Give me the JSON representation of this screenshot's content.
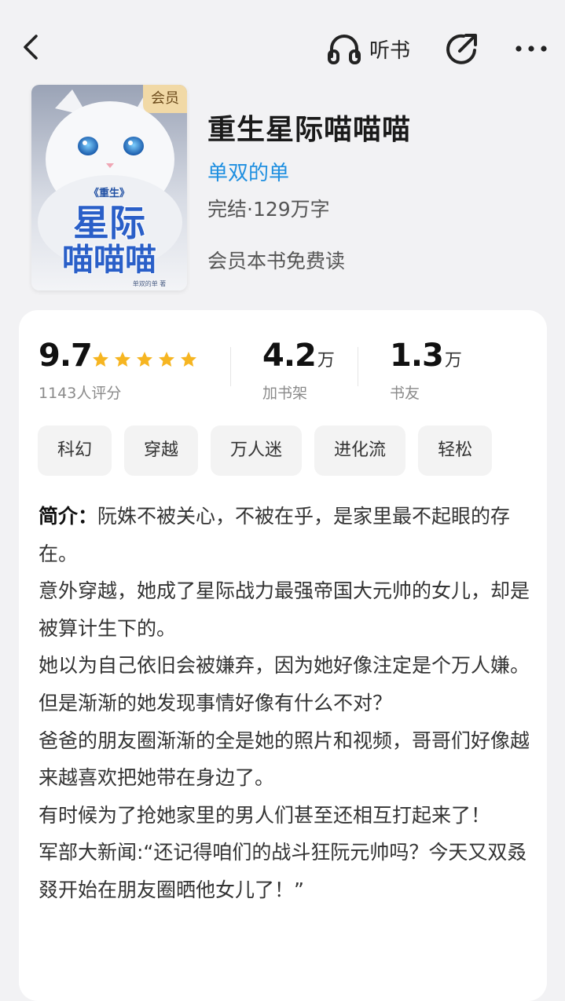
{
  "topbar": {
    "back_icon": "chevron-left-icon",
    "listen_icon": "headphones-icon",
    "listen_label": "听书",
    "share_icon": "share-icon",
    "more_icon": "more-dots-icon"
  },
  "book": {
    "cover_title_small": "《重生》",
    "cover_title_line1": "星际",
    "cover_title_line2": "喵喵喵",
    "cover_author_small": "单双的单 著",
    "cover_badge": "会员",
    "title": "重生星际喵喵喵",
    "author": "单双的单",
    "status": "完结·129万字",
    "vip_note": "会员本书免费读"
  },
  "stats": {
    "rating": "9.7",
    "rating_count": "1143人评分",
    "stars": 5,
    "shelf_count": "4.2",
    "shelf_unit": "万",
    "shelf_label": "加书架",
    "fans_count": "1.3",
    "fans_unit": "万",
    "fans_label": "书友"
  },
  "tags": [
    "科幻",
    "穿越",
    "万人迷",
    "进化流",
    "轻松"
  ],
  "intro": {
    "label": "简介：",
    "paragraphs": [
      "阮姝不被关心，不被在乎，是家里最不起眼的存在。",
      "意外穿越，她成了星际战力最强帝国大元帅的女儿，却是被算计生下的。",
      "她以为自己依旧会被嫌弃，因为她好像注定是个万人嫌。",
      "但是渐渐的她发现事情好像有什么不对？",
      "爸爸的朋友圈渐渐的全是她的照片和视频，哥哥们好像越来越喜欢把她带在身边了。",
      "有时候为了抢她家里的男人们甚至还相互打起来了！",
      "军部大新闻:“还记得咱们的战斗狂阮元帅吗？今天又双叒叕开始在朋友圈晒他女儿了！”"
    ]
  },
  "colors": {
    "accent": "#1e8fe0",
    "star": "#f6b521",
    "badge_bg": "#f1d9a6",
    "background": "#f2f2f4"
  }
}
